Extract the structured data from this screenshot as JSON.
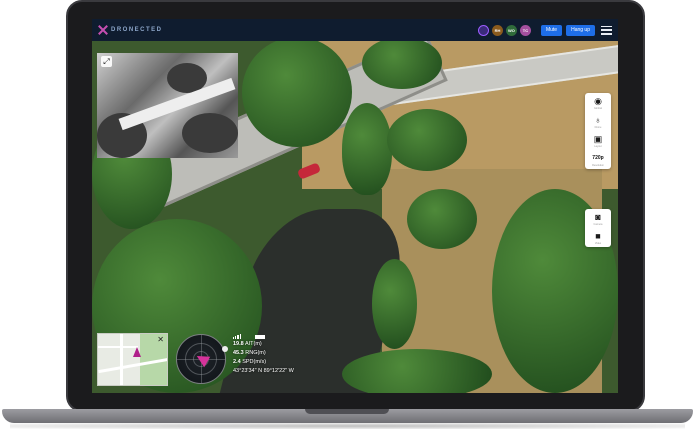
{
  "header": {
    "logo_text": "DRONECTED",
    "participants": [
      {
        "initials": "",
        "color": "#3a2b7a",
        "active": true
      },
      {
        "initials": "RH",
        "color": "#8a5a1d"
      },
      {
        "initials": "WO",
        "color": "#2f6b3a"
      },
      {
        "initials": "TC",
        "color": "#a34f9e"
      }
    ],
    "mute_label": "Mute",
    "hangup_label": "Hang up"
  },
  "right_panel": {
    "group1": [
      {
        "icon": "gimbal-icon",
        "label": "Gimbal"
      },
      {
        "icon": "drone-icon",
        "label": "Drone"
      },
      {
        "icon": "layout-icon",
        "label": "Layout"
      },
      {
        "icon": "resolution",
        "label": "Resolution",
        "text": "720p"
      }
    ],
    "group2": [
      {
        "icon": "camera-icon",
        "label": "Camera"
      },
      {
        "icon": "video-icon",
        "label": "Video"
      }
    ]
  },
  "telemetry": {
    "alt_value": "19.8",
    "alt_unit": "AIT(m)",
    "rng_value": "45.3",
    "rng_unit": "RNG(m)",
    "spd_value": "2.4",
    "spd_unit": "SPD(m/s)",
    "coords": "43°23'34\" N 89°12'22\" W"
  }
}
